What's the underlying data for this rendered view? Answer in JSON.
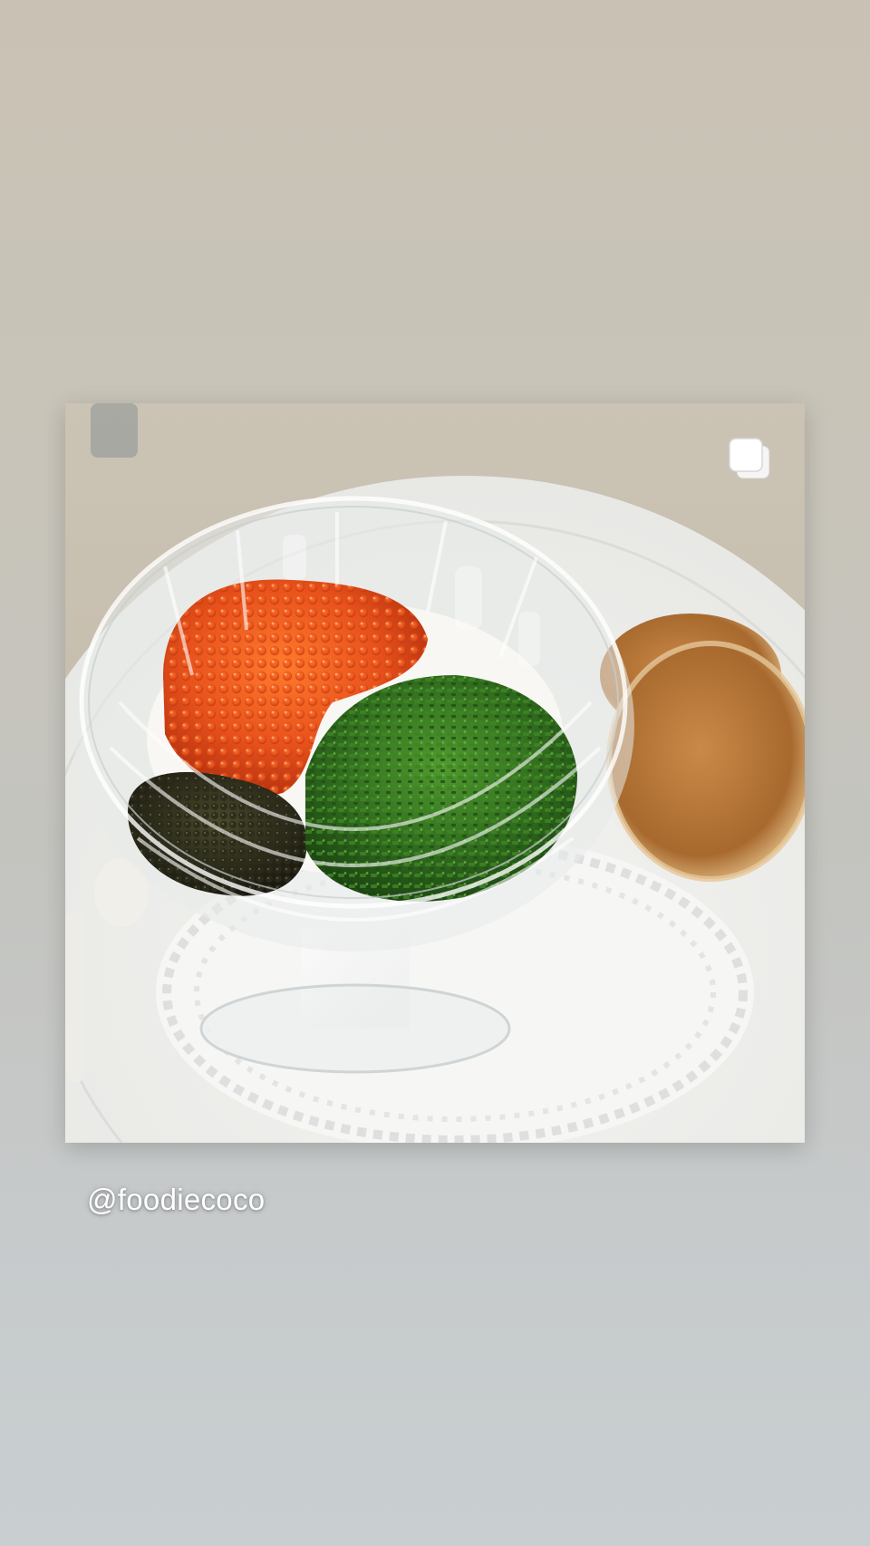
{
  "story": {
    "mention_text": "@foodiecoco",
    "background_top_color": "#c9c2b4",
    "background_bottom_color": "#c9cfd1"
  },
  "post": {
    "image": "food-photo",
    "carousel_icon": "multiple-photos-icon",
    "colors": {
      "salmon_roe": "#e8521c",
      "black_caviar": "#2b2a1c",
      "chives": "#2f6b1e",
      "blini": "#b87a3e",
      "plate": "#eeeeec",
      "countertop": "#c9c0b2"
    }
  }
}
